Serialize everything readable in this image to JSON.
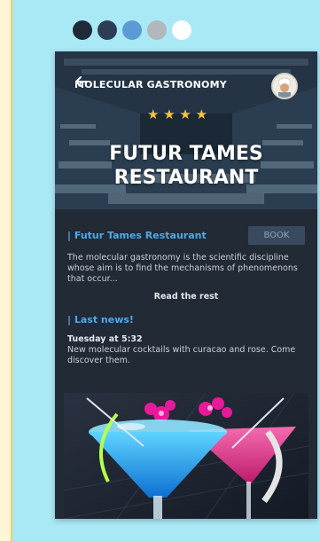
{
  "palette": [
    "#1f2a38",
    "#2c3e55",
    "#5b9bd4",
    "#b3b6ba",
    "#ffffff"
  ],
  "header": {
    "title": "MOLECULAR GASTRONOMY",
    "stars": "★ ★ ★ ★",
    "rating": 4,
    "hero_title_line1": "FUTUR TAMES",
    "hero_title_line2": "RESTAURANT"
  },
  "restaurant": {
    "section_title": "| Futur Tames Restaurant",
    "book_label": "BOOK",
    "description": "The molecular gastronomy is the scientific discipline whose aim is to find the mechanisms of phenomenons that occur...",
    "read_more": "Read the rest"
  },
  "news": {
    "section_title": "| Last news!",
    "date": "Tuesday at 5:32",
    "text": "New molecular cocktails with curacao and rose. Come discover them."
  },
  "colors": {
    "background": "#a9e8f5",
    "phone_bg": "#222a36",
    "accent_blue": "#4fa9e6",
    "star": "#f3c43c"
  }
}
